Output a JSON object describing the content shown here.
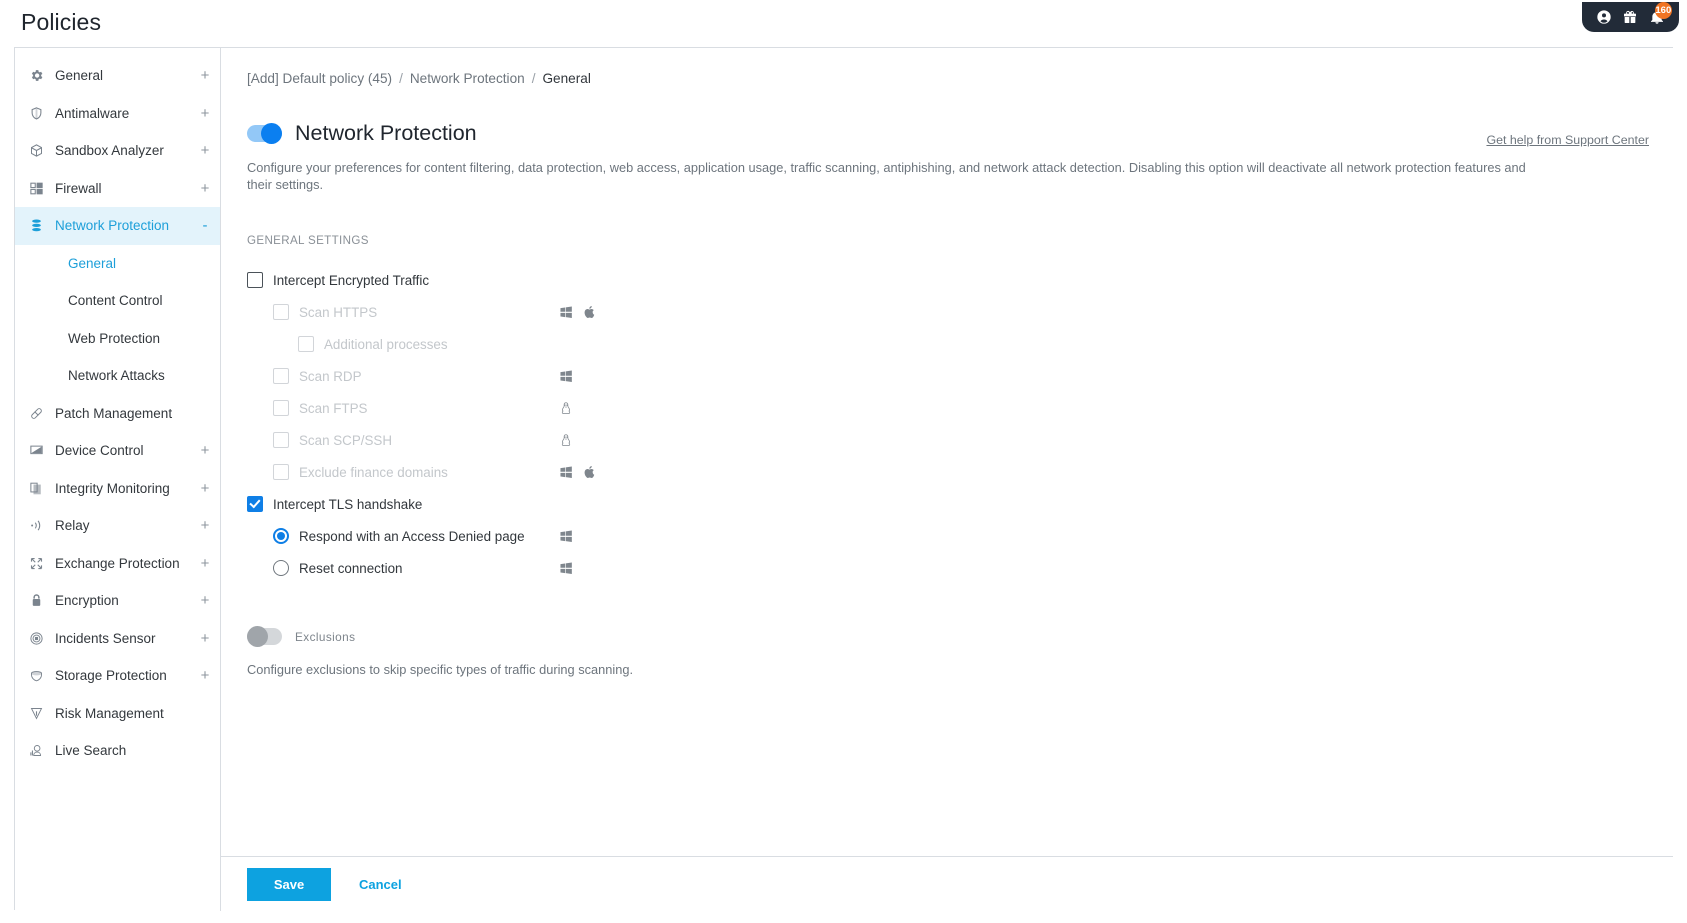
{
  "page": {
    "title": "Policies"
  },
  "topbar": {
    "account_icon": "account-circle-icon",
    "gift_icon": "gift-icon",
    "bell_icon": "bell-icon",
    "notification_count": "160"
  },
  "sidebar": {
    "items": [
      {
        "label": "General",
        "icon": "gear-icon",
        "expander": "+",
        "active": false
      },
      {
        "label": "Antimalware",
        "icon": "shield-icon",
        "expander": "+",
        "active": false
      },
      {
        "label": "Sandbox Analyzer",
        "icon": "cube-icon",
        "expander": "+",
        "active": false
      },
      {
        "label": "Firewall",
        "icon": "firewall-icon",
        "expander": "+",
        "active": false
      },
      {
        "label": "Network Protection",
        "icon": "layers-icon",
        "expander": "-",
        "active": true
      },
      {
        "label": "Patch Management",
        "icon": "patch-icon",
        "expander": "",
        "active": false
      },
      {
        "label": "Device Control",
        "icon": "monitor-icon",
        "expander": "+",
        "active": false
      },
      {
        "label": "Integrity Monitoring",
        "icon": "documents-icon",
        "expander": "+",
        "active": false
      },
      {
        "label": "Relay",
        "icon": "broadcast-icon",
        "expander": "+",
        "active": false
      },
      {
        "label": "Exchange Protection",
        "icon": "exchange-icon",
        "expander": "+",
        "active": false
      },
      {
        "label": "Encryption",
        "icon": "lock-icon",
        "expander": "+",
        "active": false
      },
      {
        "label": "Incidents Sensor",
        "icon": "sensor-icon",
        "expander": "+",
        "active": false
      },
      {
        "label": "Storage Protection",
        "icon": "storage-shield-icon",
        "expander": "+",
        "active": false
      },
      {
        "label": "Risk Management",
        "icon": "risk-icon",
        "expander": "",
        "active": false
      },
      {
        "label": "Live Search",
        "icon": "live-search-icon",
        "expander": "",
        "active": false
      }
    ],
    "subitems": [
      {
        "label": "General",
        "selected": true
      },
      {
        "label": "Content Control",
        "selected": false
      },
      {
        "label": "Web Protection",
        "selected": false
      },
      {
        "label": "Network Attacks",
        "selected": false
      }
    ]
  },
  "breadcrumb": {
    "policy": "[Add] Default policy (45)",
    "section": "Network Protection",
    "page": "General",
    "separator": "/"
  },
  "main": {
    "toggle_state": "on",
    "section_title": "Network Protection",
    "support_link": "Get help from Support Center",
    "description": "Configure your preferences for content filtering, data protection, web access, application usage, traffic scanning, antiphishing, and network attack detection. Disabling this option will deactivate all network protection features and their settings.",
    "general_settings_label": "General settings",
    "options": [
      {
        "label": "Intercept Encrypted Traffic",
        "type": "checkbox",
        "checked": false,
        "disabled": false,
        "indent": 0,
        "platforms": []
      },
      {
        "label": "Scan HTTPS",
        "type": "checkbox",
        "checked": false,
        "disabled": true,
        "indent": 1,
        "platforms": [
          "windows",
          "apple"
        ]
      },
      {
        "label": "Additional processes",
        "type": "checkbox",
        "checked": false,
        "disabled": true,
        "indent": 2,
        "platforms": []
      },
      {
        "label": "Scan RDP",
        "type": "checkbox",
        "checked": false,
        "disabled": true,
        "indent": 1,
        "platforms": [
          "windows"
        ]
      },
      {
        "label": "Scan FTPS",
        "type": "checkbox",
        "checked": false,
        "disabled": true,
        "indent": 1,
        "platforms": [
          "linux"
        ]
      },
      {
        "label": "Scan SCP/SSH",
        "type": "checkbox",
        "checked": false,
        "disabled": true,
        "indent": 1,
        "platforms": [
          "linux"
        ]
      },
      {
        "label": "Exclude finance domains",
        "type": "checkbox",
        "checked": false,
        "disabled": true,
        "indent": 1,
        "platforms": [
          "windows",
          "apple"
        ]
      },
      {
        "label": "Intercept TLS handshake",
        "type": "checkbox",
        "checked": true,
        "disabled": false,
        "indent": 0,
        "platforms": []
      },
      {
        "label": "Respond with an Access Denied page",
        "type": "radio",
        "checked": true,
        "disabled": false,
        "indent": 1,
        "platforms": [
          "windows"
        ]
      },
      {
        "label": "Reset connection",
        "type": "radio",
        "checked": false,
        "disabled": false,
        "indent": 1,
        "platforms": [
          "windows"
        ]
      }
    ],
    "exclusions": {
      "toggle_state": "off",
      "label": "Exclusions",
      "description": "Configure exclusions to skip specific types of traffic during scanning."
    }
  },
  "footer": {
    "save_label": "Save",
    "cancel_label": "Cancel"
  },
  "colors": {
    "accent": "#0da2e0",
    "active_blue": "#1d9fd9",
    "checkbox_blue": "#0f7fe6",
    "badge_orange": "#f07423",
    "topbar_dark": "#222b38"
  }
}
